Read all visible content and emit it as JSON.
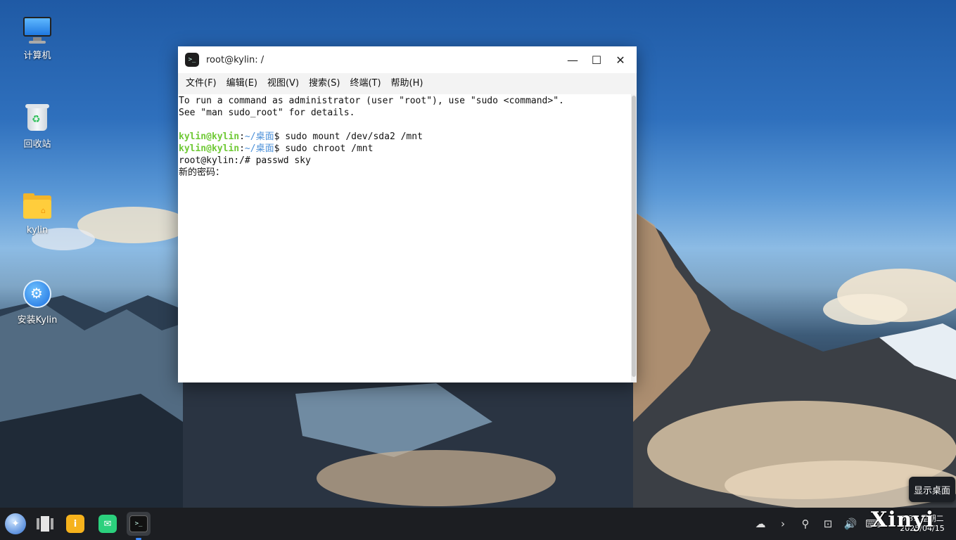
{
  "desktop": {
    "icons": [
      {
        "label": "计算机",
        "icon": "computer-icon"
      },
      {
        "label": "回收站",
        "icon": "trash-icon"
      },
      {
        "label": "kylin",
        "icon": "home-folder-icon"
      },
      {
        "label": "安装Kylin",
        "icon": "installer-icon"
      }
    ]
  },
  "terminal": {
    "title": "root@kylin: /",
    "controls": {
      "minimize": "—",
      "maximize": "☐",
      "close": "✕"
    },
    "menu": [
      "文件(F)",
      "编辑(E)",
      "视图(V)",
      "搜索(S)",
      "终端(T)",
      "帮助(H)"
    ],
    "lines": {
      "l1": "To run a command as administrator (user \"root\"), use \"sudo <command>\".",
      "l2": "See \"man sudo_root\" for details.",
      "prompt_user": "kylin@kylin",
      "prompt_sep": ":",
      "prompt_path": "~/桌面",
      "prompt_end": "$ ",
      "cmd1": "sudo mount /dev/sda2 /mnt",
      "cmd2": "sudo chroot /mnt",
      "l5": "root@kylin:/# passwd sky",
      "l6": "新的密码："
    }
  },
  "tooltip": {
    "text": "显示桌面"
  },
  "taskbar": {
    "apps": [
      "start-menu-icon",
      "multitask-view-icon",
      "app-store-icon",
      "mail-icon",
      "terminal-icon"
    ],
    "tray": [
      "cloud-icon",
      "chevron-right-icon",
      "search-icon",
      "network-icon",
      "volume-icon",
      "keyboard-icon"
    ],
    "clock": {
      "time": "0:39 星期二",
      "date": "2025/04/15"
    }
  },
  "watermark": "Xinyi"
}
